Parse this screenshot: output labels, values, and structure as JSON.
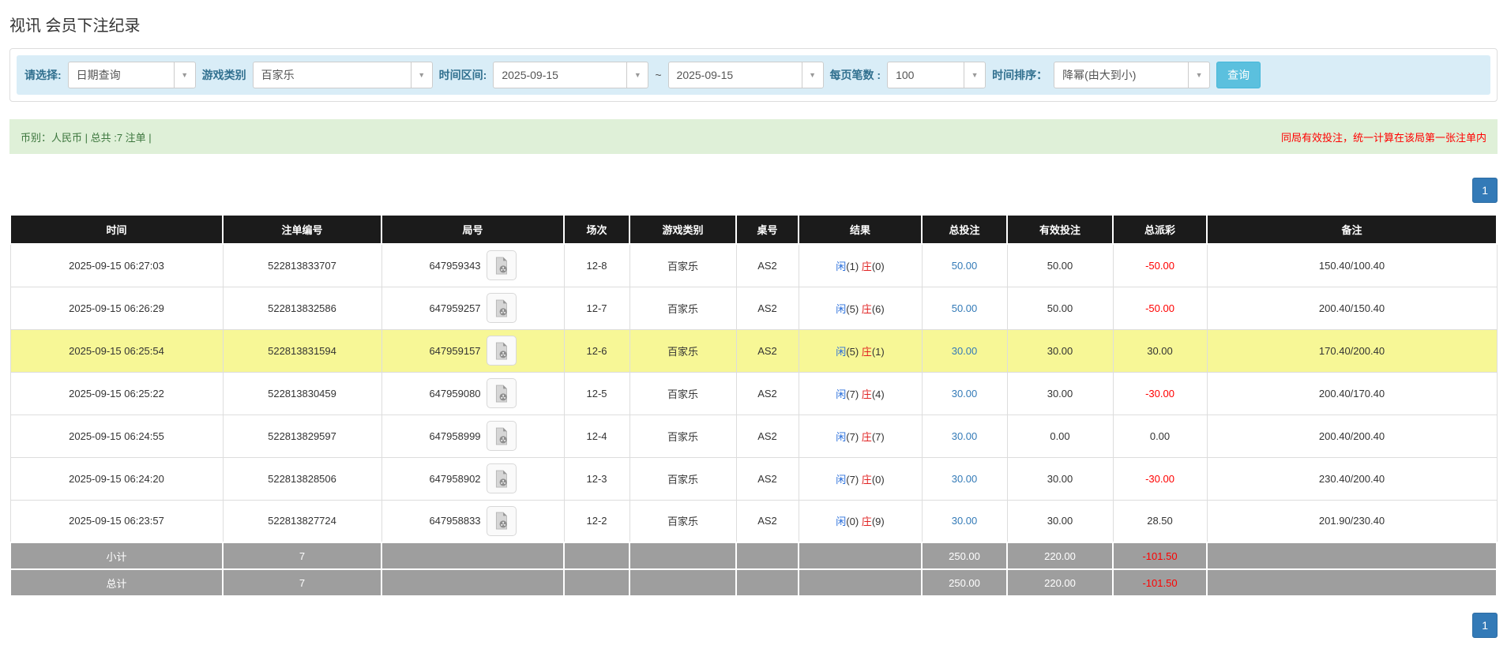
{
  "page_title": "视讯 会员下注纪录",
  "filters": {
    "select_label": "请选择:",
    "select_value": "日期查询",
    "game_label": "游戏类别",
    "game_value": "百家乐",
    "range_label": "时间区间:",
    "date_from": "2025-09-15",
    "range_separator": "~",
    "date_to": "2025-09-15",
    "page_size_label": "每页笔数 :",
    "page_size_value": "100",
    "sort_label": "时间排序：",
    "sort_value": "降幂(由大到小)",
    "search_button": "查询"
  },
  "summary": {
    "left": "币别：人民币 | 总共 :7 注单 |",
    "notice": "同局有效投注，统一计算在该局第一张注单内"
  },
  "pagination": {
    "page": "1"
  },
  "colors": {
    "accent_blue": "#337ab7",
    "search_button": "#5bc0de",
    "filter_bar_bg": "#d9edf7",
    "summary_bg": "#dff0d8",
    "notice_red": "#ff0000",
    "highlight_row": "#f7f796",
    "header_bg": "#1b1b1b",
    "footer_bg": "#9e9e9e",
    "player_blue": "#2a6fdb",
    "banker_red": "#e02222"
  },
  "table": {
    "headers": [
      "时间",
      "注单编号",
      "局号",
      "场次",
      "游戏类别",
      "桌号",
      "结果",
      "总投注",
      "有效投注",
      "总派彩",
      "备注"
    ],
    "result_labels": {
      "player": "闲",
      "banker": "庄"
    },
    "rows": [
      {
        "time": "2025-09-15 06:27:03",
        "bet_id": "522813833707",
        "round_id": "647959343",
        "session": "12-8",
        "game": "百家乐",
        "table_no": "AS2",
        "player": "(1)",
        "banker": "(0)",
        "total_bet": "50.00",
        "valid_bet": "50.00",
        "payout": "-50.00",
        "note": "150.40/100.40",
        "highlight": false
      },
      {
        "time": "2025-09-15 06:26:29",
        "bet_id": "522813832586",
        "round_id": "647959257",
        "session": "12-7",
        "game": "百家乐",
        "table_no": "AS2",
        "player": "(5)",
        "banker": "(6)",
        "total_bet": "50.00",
        "valid_bet": "50.00",
        "payout": "-50.00",
        "note": "200.40/150.40",
        "highlight": false
      },
      {
        "time": "2025-09-15 06:25:54",
        "bet_id": "522813831594",
        "round_id": "647959157",
        "session": "12-6",
        "game": "百家乐",
        "table_no": "AS2",
        "player": "(5)",
        "banker": "(1)",
        "total_bet": "30.00",
        "valid_bet": "30.00",
        "payout": "30.00",
        "note": "170.40/200.40",
        "highlight": true
      },
      {
        "time": "2025-09-15 06:25:22",
        "bet_id": "522813830459",
        "round_id": "647959080",
        "session": "12-5",
        "game": "百家乐",
        "table_no": "AS2",
        "player": "(7)",
        "banker": "(4)",
        "total_bet": "30.00",
        "valid_bet": "30.00",
        "payout": "-30.00",
        "note": "200.40/170.40",
        "highlight": false
      },
      {
        "time": "2025-09-15 06:24:55",
        "bet_id": "522813829597",
        "round_id": "647958999",
        "session": "12-4",
        "game": "百家乐",
        "table_no": "AS2",
        "player": "(7)",
        "banker": "(7)",
        "total_bet": "30.00",
        "valid_bet": "0.00",
        "payout": "0.00",
        "note": "200.40/200.40",
        "highlight": false
      },
      {
        "time": "2025-09-15 06:24:20",
        "bet_id": "522813828506",
        "round_id": "647958902",
        "session": "12-3",
        "game": "百家乐",
        "table_no": "AS2",
        "player": "(7)",
        "banker": "(0)",
        "total_bet": "30.00",
        "valid_bet": "30.00",
        "payout": "-30.00",
        "note": "230.40/200.40",
        "highlight": false
      },
      {
        "time": "2025-09-15 06:23:57",
        "bet_id": "522813827724",
        "round_id": "647958833",
        "session": "12-2",
        "game": "百家乐",
        "table_no": "AS2",
        "player": "(0)",
        "banker": "(9)",
        "total_bet": "30.00",
        "valid_bet": "30.00",
        "payout": "28.50",
        "note": "201.90/230.40",
        "highlight": false
      }
    ],
    "footer": [
      {
        "label": "小计",
        "count": "7",
        "total_bet": "250.00",
        "valid_bet": "220.00",
        "payout": "-101.50"
      },
      {
        "label": "总计",
        "count": "7",
        "total_bet": "250.00",
        "valid_bet": "220.00",
        "payout": "-101.50"
      }
    ]
  }
}
